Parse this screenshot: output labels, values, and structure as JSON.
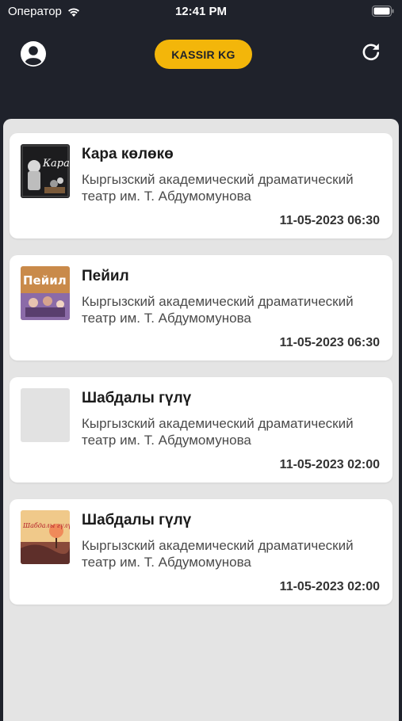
{
  "status_bar": {
    "carrier": "Оператор",
    "time": "12:41 PM"
  },
  "header": {
    "brand": "KASSIR KG",
    "brand_color": "#f3b60a",
    "left_icon": "user-avatar-icon",
    "right_icon": "refresh-icon"
  },
  "events": [
    {
      "title": "Кара көлөкө",
      "poster_text": "Кара",
      "venue": "Кыргызский академический драматический театр им. Т. Абдумомунова",
      "datetime": "11-05-2023 06:30"
    },
    {
      "title": "Пейил",
      "poster_text": "Пейил",
      "venue": "Кыргызский академический драматический театр им. Т. Абдумомунова",
      "datetime": "11-05-2023 06:30"
    },
    {
      "title": "Шабдалы гүлү",
      "venue": "Кыргызский академический драматический театр им. Т. Абдумомунова",
      "datetime": "11-05-2023 02:00"
    },
    {
      "title": "Шабдалы гүлү",
      "poster_text": "Шабдалы гүлү",
      "venue": "Кыргызский академический драматический театр им. Т. Абдумомунова",
      "datetime": "11-05-2023 02:00"
    }
  ]
}
